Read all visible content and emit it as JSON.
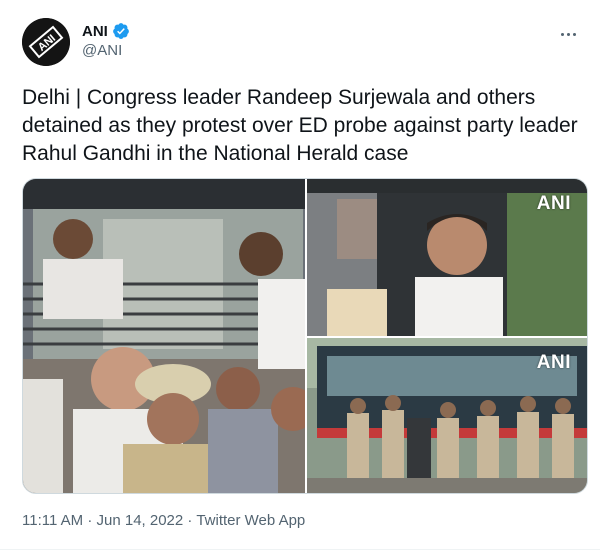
{
  "author": {
    "name": "ANI",
    "handle": "@ANI",
    "avatar_text": "ANI",
    "verified_color": "#1d9bf0"
  },
  "tweet": {
    "text": "Delhi | Congress leader Randeep Surjewala and others detained as they protest over ED probe against party leader Rahul Gandhi in the National Herald case"
  },
  "media": {
    "watermark": "ANI",
    "photos": [
      "left-photo",
      "top-right-photo",
      "bottom-right-photo"
    ]
  },
  "meta": {
    "time": "11:11 AM",
    "separator": "·",
    "date": "Jun 14, 2022",
    "source": "Twitter Web App"
  },
  "icons": {
    "more": "more-horizontal-icon",
    "verified": "verified-badge-icon"
  }
}
